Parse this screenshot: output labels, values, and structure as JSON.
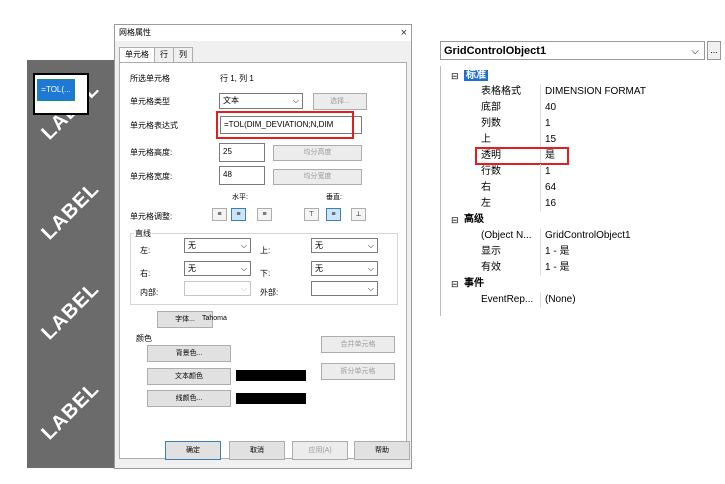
{
  "canvas": {
    "watermark": "LABEL",
    "cell_text": "=TOL(..."
  },
  "dialog": {
    "title": "网格属性",
    "close": "×",
    "tabs": [
      "单元格",
      "行",
      "列"
    ],
    "selected_cell_label": "所选单元格",
    "selected_cell_value": "行 1, 列 1",
    "cell_type_label": "单元格类型",
    "cell_type_value": "文本",
    "select_button": "选择...",
    "expr_label": "单元格表达式",
    "expr_value": "=TOL(DIM_DEVIATION;N,DIM",
    "height_label": "单元格高度:",
    "height_value": "25",
    "equal_height": "均分高度",
    "width_label": "单元格宽度:",
    "width_value": "48",
    "equal_width": "均分宽度",
    "horizontal": "水平:",
    "vertical": "垂直:",
    "adjust_label": "单元格调整:",
    "lines_group": "直线",
    "left_label": "左:",
    "left_value": "无",
    "top_label": "上:",
    "top_value": "无",
    "right_label": "右:",
    "right_value": "无",
    "bottom_label": "下:",
    "bottom_value": "无",
    "inner_label": "内部:",
    "outer_label": "外部:",
    "font_button": "字体...",
    "font_name": "Tahoma",
    "color_group": "颜色",
    "bg_button": "背景色...",
    "text_color_button": "文本颜色",
    "line_color_button": "线颜色...",
    "merge_button": "合并单元格",
    "split_button": "拆分单元格",
    "ok": "确定",
    "cancel": "取消",
    "apply": "应用(A)",
    "help": "帮助"
  },
  "propgrid": {
    "object": "GridControlObject1",
    "dots": "...",
    "categories": {
      "standard": "标准",
      "advanced": "高级",
      "events": "事件"
    },
    "rows": [
      {
        "k": "表格格式",
        "v": "DIMENSION FORMAT"
      },
      {
        "k": "底部",
        "v": "40"
      },
      {
        "k": "列数",
        "v": "1"
      },
      {
        "k": "上",
        "v": "15"
      },
      {
        "k": "透明",
        "v": "是"
      },
      {
        "k": "行数",
        "v": "1"
      },
      {
        "k": "右",
        "v": "64"
      },
      {
        "k": "左",
        "v": "16"
      }
    ],
    "adv_rows": [
      {
        "k": "(Object N...",
        "v": "GridControlObject1"
      },
      {
        "k": "显示",
        "v": "1 - 是"
      },
      {
        "k": "有效",
        "v": "1 - 是"
      }
    ],
    "evt_rows": [
      {
        "k": "EventRep...",
        "v": "(None)"
      }
    ]
  }
}
